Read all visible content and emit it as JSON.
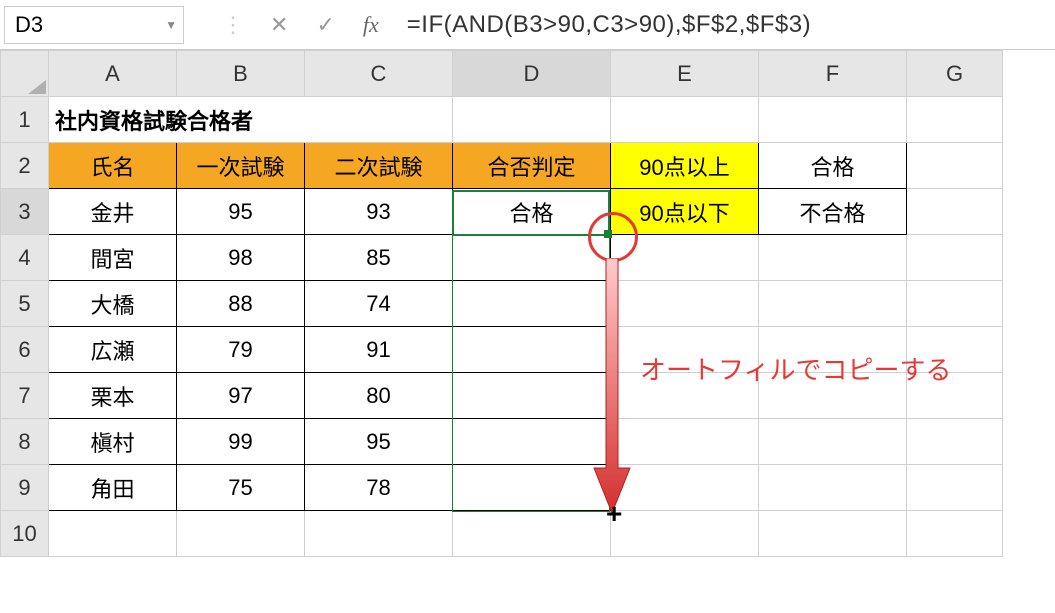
{
  "nameBox": "D3",
  "formula": "=IF(AND(B3>90,C3>90),$F$2,$F$3)",
  "fxLabel": "fx",
  "columns": [
    "A",
    "B",
    "C",
    "D",
    "E",
    "F",
    "G"
  ],
  "rowNums": [
    "1",
    "2",
    "3",
    "4",
    "5",
    "6",
    "7",
    "8",
    "9",
    "10"
  ],
  "title": "社内資格試験合格者",
  "headers": {
    "A": "氏名",
    "B": "一次試験",
    "C": "二次試験",
    "D": "合否判定"
  },
  "legend": {
    "r2E": "90点以上",
    "r2F": "合格",
    "r3E": "90点以下",
    "r3F": "不合格"
  },
  "dataRows": [
    {
      "name": "金井",
      "s1": "95",
      "s2": "93",
      "result": "合格"
    },
    {
      "name": "間宮",
      "s1": "98",
      "s2": "85",
      "result": ""
    },
    {
      "name": "大橋",
      "s1": "88",
      "s2": "74",
      "result": ""
    },
    {
      "name": "広瀬",
      "s1": "79",
      "s2": "91",
      "result": ""
    },
    {
      "name": "栗本",
      "s1": "97",
      "s2": "80",
      "result": ""
    },
    {
      "name": "槇村",
      "s1": "99",
      "s2": "95",
      "result": ""
    },
    {
      "name": "角田",
      "s1": "75",
      "s2": "78",
      "result": ""
    }
  ],
  "annotation": "オートフィルでコピーする",
  "fillCursor": "+",
  "icons": {
    "dots": "⋮",
    "cancel": "✕",
    "confirm": "✓",
    "dropdown": "▼"
  },
  "chart_data": {
    "type": "table",
    "title": "社内資格試験合格者",
    "columns": [
      "氏名",
      "一次試験",
      "二次試験",
      "合否判定"
    ],
    "rows": [
      [
        "金井",
        95,
        93,
        "合格"
      ],
      [
        "間宮",
        98,
        85,
        ""
      ],
      [
        "大橋",
        88,
        74,
        ""
      ],
      [
        "広瀬",
        79,
        91,
        ""
      ],
      [
        "栗本",
        97,
        80,
        ""
      ],
      [
        "槇村",
        99,
        95,
        ""
      ],
      [
        "角田",
        75,
        78,
        ""
      ]
    ],
    "legend": [
      [
        "90点以上",
        "合格"
      ],
      [
        "90点以下",
        "不合格"
      ]
    ],
    "formula_D3": "=IF(AND(B3>90,C3>90),$F$2,$F$3)"
  }
}
